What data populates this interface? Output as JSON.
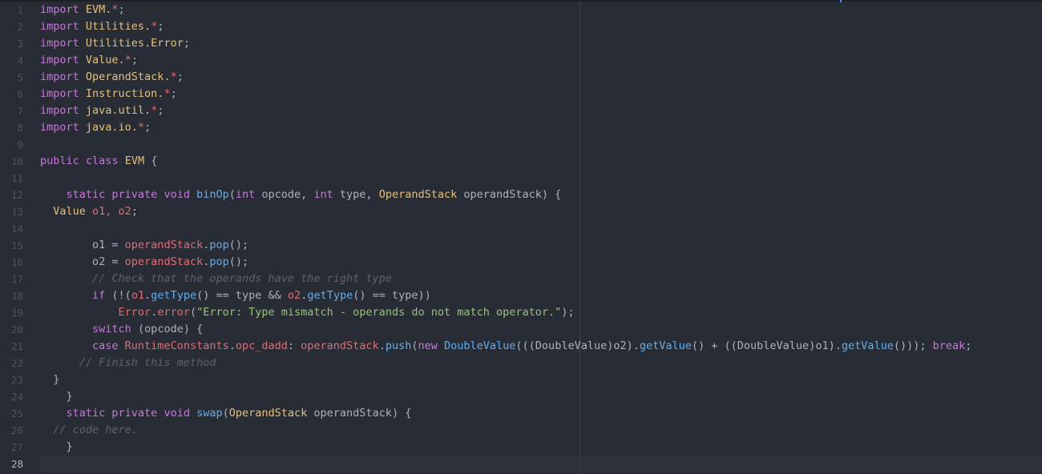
{
  "editor": {
    "language": "java",
    "active_line": 28,
    "line_numbers": [
      "1",
      "2",
      "3",
      "4",
      "5",
      "6",
      "7",
      "8",
      "9",
      "10",
      "11",
      "12",
      "13",
      "14",
      "15",
      "16",
      "17",
      "18",
      "19",
      "20",
      "21",
      "22",
      "23",
      "24",
      "25",
      "26",
      "27",
      "28"
    ],
    "lines": [
      [
        {
          "t": "import ",
          "c": "kw"
        },
        {
          "t": "EVM.",
          "c": "cls"
        },
        {
          "t": "*",
          "c": "star"
        },
        {
          "t": ";",
          "c": "plain"
        }
      ],
      [
        {
          "t": "import ",
          "c": "kw"
        },
        {
          "t": "Utilities.",
          "c": "cls"
        },
        {
          "t": "*",
          "c": "star"
        },
        {
          "t": ";",
          "c": "plain"
        }
      ],
      [
        {
          "t": "import ",
          "c": "kw"
        },
        {
          "t": "Utilities.Error",
          "c": "cls"
        },
        {
          "t": ";",
          "c": "plain"
        }
      ],
      [
        {
          "t": "import ",
          "c": "kw"
        },
        {
          "t": "Value.",
          "c": "cls"
        },
        {
          "t": "*",
          "c": "star"
        },
        {
          "t": ";",
          "c": "plain"
        }
      ],
      [
        {
          "t": "import ",
          "c": "kw"
        },
        {
          "t": "OperandStack.",
          "c": "cls"
        },
        {
          "t": "*",
          "c": "star"
        },
        {
          "t": ";",
          "c": "plain"
        }
      ],
      [
        {
          "t": "import ",
          "c": "kw"
        },
        {
          "t": "Instruction.",
          "c": "cls"
        },
        {
          "t": "*",
          "c": "star"
        },
        {
          "t": ";",
          "c": "plain"
        }
      ],
      [
        {
          "t": "import ",
          "c": "kw"
        },
        {
          "t": "java.util.",
          "c": "cls"
        },
        {
          "t": "*",
          "c": "star"
        },
        {
          "t": ";",
          "c": "plain"
        }
      ],
      [
        {
          "t": "import ",
          "c": "kw"
        },
        {
          "t": "java.io.",
          "c": "cls"
        },
        {
          "t": "*",
          "c": "star"
        },
        {
          "t": ";",
          "c": "plain"
        }
      ],
      [],
      [
        {
          "t": "public ",
          "c": "kw"
        },
        {
          "t": "class ",
          "c": "kw"
        },
        {
          "t": "EVM",
          "c": "cls"
        },
        {
          "t": " {",
          "c": "plain"
        }
      ],
      [],
      [
        {
          "t": "    static ",
          "c": "kw"
        },
        {
          "t": "private ",
          "c": "kw"
        },
        {
          "t": "void ",
          "c": "kw"
        },
        {
          "t": "binOp",
          "c": "fn"
        },
        {
          "t": "(",
          "c": "plain"
        },
        {
          "t": "int ",
          "c": "kw"
        },
        {
          "t": "opcode, ",
          "c": "plain"
        },
        {
          "t": "int ",
          "c": "kw"
        },
        {
          "t": "type, ",
          "c": "plain"
        },
        {
          "t": "OperandStack ",
          "c": "cls"
        },
        {
          "t": "operandStack) {",
          "c": "plain"
        }
      ],
      [
        {
          "t": "  Value ",
          "c": "cls"
        },
        {
          "t": "o1, o2",
          "c": "var"
        },
        {
          "t": ";",
          "c": "plain"
        }
      ],
      [],
      [
        {
          "t": "        o1 = ",
          "c": "plain"
        },
        {
          "t": "operandStack",
          "c": "var"
        },
        {
          "t": ".",
          "c": "plain"
        },
        {
          "t": "pop",
          "c": "fn"
        },
        {
          "t": "();",
          "c": "plain"
        }
      ],
      [
        {
          "t": "        o2 = ",
          "c": "plain"
        },
        {
          "t": "operandStack",
          "c": "var"
        },
        {
          "t": ".",
          "c": "plain"
        },
        {
          "t": "pop",
          "c": "fn"
        },
        {
          "t": "();",
          "c": "plain"
        }
      ],
      [
        {
          "t": "        // Check that the operands have the right type",
          "c": "com"
        }
      ],
      [
        {
          "t": "        ",
          "c": "plain"
        },
        {
          "t": "if ",
          "c": "kw"
        },
        {
          "t": "(!(",
          "c": "plain"
        },
        {
          "t": "o1",
          "c": "var"
        },
        {
          "t": ".",
          "c": "plain"
        },
        {
          "t": "getType",
          "c": "fn"
        },
        {
          "t": "() == type && ",
          "c": "plain"
        },
        {
          "t": "o2",
          "c": "var"
        },
        {
          "t": ".",
          "c": "plain"
        },
        {
          "t": "getType",
          "c": "fn"
        },
        {
          "t": "() == type))",
          "c": "plain"
        }
      ],
      [
        {
          "t": "            ",
          "c": "plain"
        },
        {
          "t": "Error",
          "c": "var"
        },
        {
          "t": ".",
          "c": "plain"
        },
        {
          "t": "error",
          "c": "var"
        },
        {
          "t": "(",
          "c": "plain"
        },
        {
          "t": "\"Error: Type mismatch - operands do not match operator.\"",
          "c": "str"
        },
        {
          "t": ");",
          "c": "plain"
        }
      ],
      [
        {
          "t": "        ",
          "c": "plain"
        },
        {
          "t": "switch ",
          "c": "kw"
        },
        {
          "t": "(opcode) {",
          "c": "plain"
        }
      ],
      [
        {
          "t": "        ",
          "c": "plain"
        },
        {
          "t": "case ",
          "c": "kw"
        },
        {
          "t": "RuntimeConstants",
          "c": "var"
        },
        {
          "t": ".",
          "c": "plain"
        },
        {
          "t": "opc_dadd",
          "c": "var"
        },
        {
          "t": ": ",
          "c": "plain"
        },
        {
          "t": "operandStack",
          "c": "var"
        },
        {
          "t": ".",
          "c": "plain"
        },
        {
          "t": "push",
          "c": "fn"
        },
        {
          "t": "(",
          "c": "plain"
        },
        {
          "t": "new ",
          "c": "kw"
        },
        {
          "t": "DoubleValue",
          "c": "fn"
        },
        {
          "t": "(((DoubleValue)o2).",
          "c": "plain"
        },
        {
          "t": "getValue",
          "c": "fn"
        },
        {
          "t": "() + ((DoubleValue)o1).",
          "c": "plain"
        },
        {
          "t": "getValue",
          "c": "fn"
        },
        {
          "t": "())); ",
          "c": "plain"
        },
        {
          "t": "break",
          "c": "kw"
        },
        {
          "t": ";",
          "c": "plain"
        }
      ],
      [
        {
          "t": "      // Finish this method",
          "c": "com"
        }
      ],
      [
        {
          "t": "  }",
          "c": "plain"
        }
      ],
      [
        {
          "t": "    }",
          "c": "plain"
        }
      ],
      [
        {
          "t": "    static ",
          "c": "kw"
        },
        {
          "t": "private ",
          "c": "kw"
        },
        {
          "t": "void ",
          "c": "kw"
        },
        {
          "t": "swap",
          "c": "fn"
        },
        {
          "t": "(",
          "c": "plain"
        },
        {
          "t": "OperandStack ",
          "c": "cls"
        },
        {
          "t": "operandStack) {",
          "c": "plain"
        }
      ],
      [
        {
          "t": "  // code here.",
          "c": "com"
        }
      ],
      [
        {
          "t": "    }",
          "c": "plain"
        }
      ],
      []
    ]
  }
}
